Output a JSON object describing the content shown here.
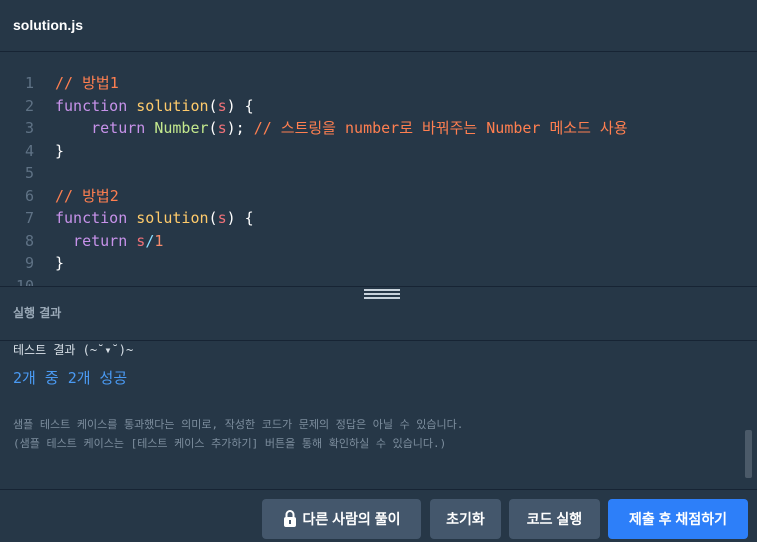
{
  "header": {
    "tab_title": "solution.js"
  },
  "editor": {
    "lines": [
      {
        "n": "1",
        "tokens": [
          {
            "t": "// 방법1",
            "c": "cm"
          }
        ]
      },
      {
        "n": "2",
        "tokens": [
          {
            "t": "function ",
            "c": "kw"
          },
          {
            "t": "solution",
            "c": "fn"
          },
          {
            "t": "(",
            "c": "pn"
          },
          {
            "t": "s",
            "c": "pa"
          },
          {
            "t": ") {",
            "c": "pn"
          }
        ]
      },
      {
        "n": "3",
        "tokens": [
          {
            "t": "    return ",
            "c": "kw"
          },
          {
            "t": "Number",
            "c": "nb"
          },
          {
            "t": "(",
            "c": "pn"
          },
          {
            "t": "s",
            "c": "pa"
          },
          {
            "t": "); ",
            "c": "pn"
          },
          {
            "t": "// 스트링을 number로 바꿔주는 Number 메소드 사용",
            "c": "cm"
          }
        ]
      },
      {
        "n": "4",
        "tokens": [
          {
            "t": "}",
            "c": "pn"
          }
        ]
      },
      {
        "n": "5",
        "tokens": []
      },
      {
        "n": "6",
        "tokens": [
          {
            "t": "// 방법2",
            "c": "cm"
          }
        ]
      },
      {
        "n": "7",
        "tokens": [
          {
            "t": "function ",
            "c": "kw"
          },
          {
            "t": "solution",
            "c": "fn"
          },
          {
            "t": "(",
            "c": "pn"
          },
          {
            "t": "s",
            "c": "pa"
          },
          {
            "t": ") {",
            "c": "pn"
          }
        ]
      },
      {
        "n": "8",
        "tokens": [
          {
            "t": "  return ",
            "c": "kw"
          },
          {
            "t": "s",
            "c": "pa"
          },
          {
            "t": "/",
            "c": "op"
          },
          {
            "t": "1",
            "c": "nm"
          }
        ]
      },
      {
        "n": "9",
        "tokens": [
          {
            "t": "}",
            "c": "pn"
          }
        ]
      },
      {
        "n": "10",
        "tokens": []
      }
    ]
  },
  "result": {
    "title": "실행 결과",
    "heading": "테스트 결과 (~˘▾˘)~",
    "summary": "2개 중 2개 성공",
    "note1": "샘플 테스트 케이스를 통과했다는 의미로, 작성한 코드가 문제의 정답은 아닐 수 있습니다.",
    "note2": "(샘플 테스트 케이스는 [테스트 케이스 추가하기] 버튼을 통해 확인하실 수 있습니다.)"
  },
  "footer": {
    "others_label": "다른 사람의 풀이",
    "reset_label": "초기화",
    "run_label": "코드 실행",
    "submit_label": "제출 후 채점하기"
  },
  "icons": {
    "others": "lock-icon"
  },
  "colors": {
    "background": "#263747",
    "accent": "#2d7ff9",
    "button": "#44576c",
    "success": "#4a9af3"
  }
}
